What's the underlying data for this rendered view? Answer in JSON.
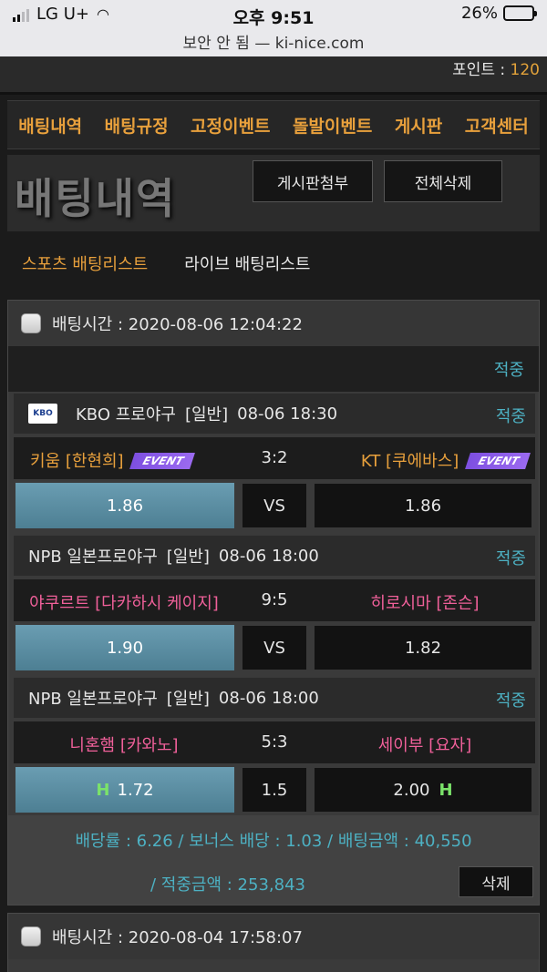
{
  "status_bar": {
    "carrier": "LG U+",
    "time": "오후 9:51",
    "battery": "26%",
    "url": "보안 안 됨 — ki-nice.com"
  },
  "points": {
    "label": "포인트 : ",
    "value": "120"
  },
  "nav": [
    "배팅내역",
    "배팅규정",
    "고정이벤트",
    "돌발이벤트",
    "게시판",
    "고객센터"
  ],
  "page": {
    "title": "배팅내역",
    "attach_btn": "게시판첨부",
    "delete_all_btn": "전체삭제"
  },
  "tabs": {
    "sports": "스포츠 배팅리스트",
    "live": "라이브 배팅리스트"
  },
  "bet1": {
    "time_label": "배팅시간 : 2020-08-06 12:04:22",
    "status": "적중",
    "games": [
      {
        "logo": "KBO",
        "league": "KBO 프로야구",
        "type": "[일반]",
        "datetime": "08-06 18:30",
        "result": "적중",
        "home": "키움 [한현희]",
        "away": "KT [쿠에바스]",
        "event": "EVENT",
        "score": "3:2",
        "home_odds": "1.86",
        "mid": "VS",
        "away_odds": "1.86"
      },
      {
        "league": "NPB 일본프로야구",
        "type": "[일반]",
        "datetime": "08-06 18:00",
        "result": "적중",
        "home": "야쿠르트 [다카하시 케이지]",
        "away": "히로시마 [존슨]",
        "score": "9:5",
        "home_odds": "1.90",
        "mid": "VS",
        "away_odds": "1.82"
      },
      {
        "league": "NPB 일본프로야구",
        "type": "[일반]",
        "datetime": "08-06 18:00",
        "result": "적중",
        "home": "니혼햄 [카와노]",
        "away": "세이부 [요자]",
        "score": "5:3",
        "h_mark": "H",
        "home_odds": "1.72",
        "mid": "1.5",
        "away_odds": "2.00"
      }
    ],
    "summary_line1": "배당률 : 6.26 / 보너스 배당 : 1.03 / 배팅금액 : 40,550",
    "summary_line2": "/ 적중금액 : 253,843",
    "delete_btn": "삭제"
  },
  "bet2": {
    "time_label": "배팅시간 : 2020-08-04 17:58:07"
  }
}
